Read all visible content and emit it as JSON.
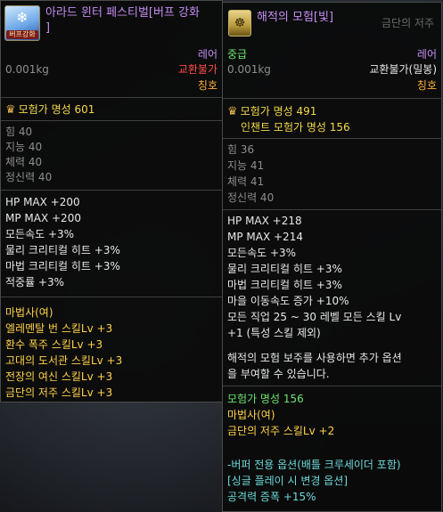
{
  "left": {
    "icon_badge": "버프강화",
    "name_line1": "아라드 윈터 페스티벌[버프 강화",
    "name_line2": "]",
    "rarity": "레어",
    "weight": "0.001kg",
    "trade": "교환불가",
    "type": "칭호",
    "fame": "모험가 명성 601",
    "stats": [
      "힘 40",
      "지능 40",
      "체력 40",
      "정신력 40"
    ],
    "effects": [
      "HP MAX +200",
      "MP MAX +200",
      "모든속도 +3%",
      "물리 크리티컬 히트 +3%",
      "마법 크리티컬 히트 +3%",
      "적중률 +3%"
    ],
    "buff_class": "마법사(여)",
    "skills": [
      "엘레멘탈 번 스킬Lv +3",
      "환수 폭주 스킬Lv +3",
      "고대의 도서관 스킬Lv +3",
      "전장의 여신 스킬Lv +3",
      "금단의 저주 스킬Lv +3"
    ]
  },
  "right": {
    "name": "해적의 모험[빛]",
    "grade": "중급",
    "rarity": "레어",
    "weight": "0.001kg",
    "trade": "교환불가(밀봉)",
    "type": "칭호",
    "fame": "모험가 명성 491",
    "enchant_fame": "인챈트 모험가 명성 156",
    "stats": [
      "힘 36",
      "지능 41",
      "체력 41",
      "정신력 40"
    ],
    "effects": [
      "HP MAX +218",
      "MP MAX +214",
      "모든속도 +3%",
      "물리 크리티컬 히트 +3%",
      "마법 크리티컬 히트 +3%",
      "마을 이동속도 증가 +10%",
      "모든 직업 25 ~ 30 레벨 모든 스킬 Lv",
      "+1 (특성 스킬 제외)"
    ],
    "note_line1": "해적의 모험 보주를 사용하면 추가 옵션",
    "note_line2": "을 부여할 수 있습니다.",
    "extra_fame": "모험가 명성 156",
    "buff_class": "마법사(여)",
    "buff_skill": "금단의 저주 스킬Lv +2",
    "buffer_option_line1": "-버퍼 전용 옵션(배틀 크루세이더 포함)",
    "buffer_option_line2": "[싱글 플레이 시 변경 옵션]",
    "buffer_option_line3": "공격력 증폭 +15%"
  },
  "background_hint": "금단의 저주"
}
